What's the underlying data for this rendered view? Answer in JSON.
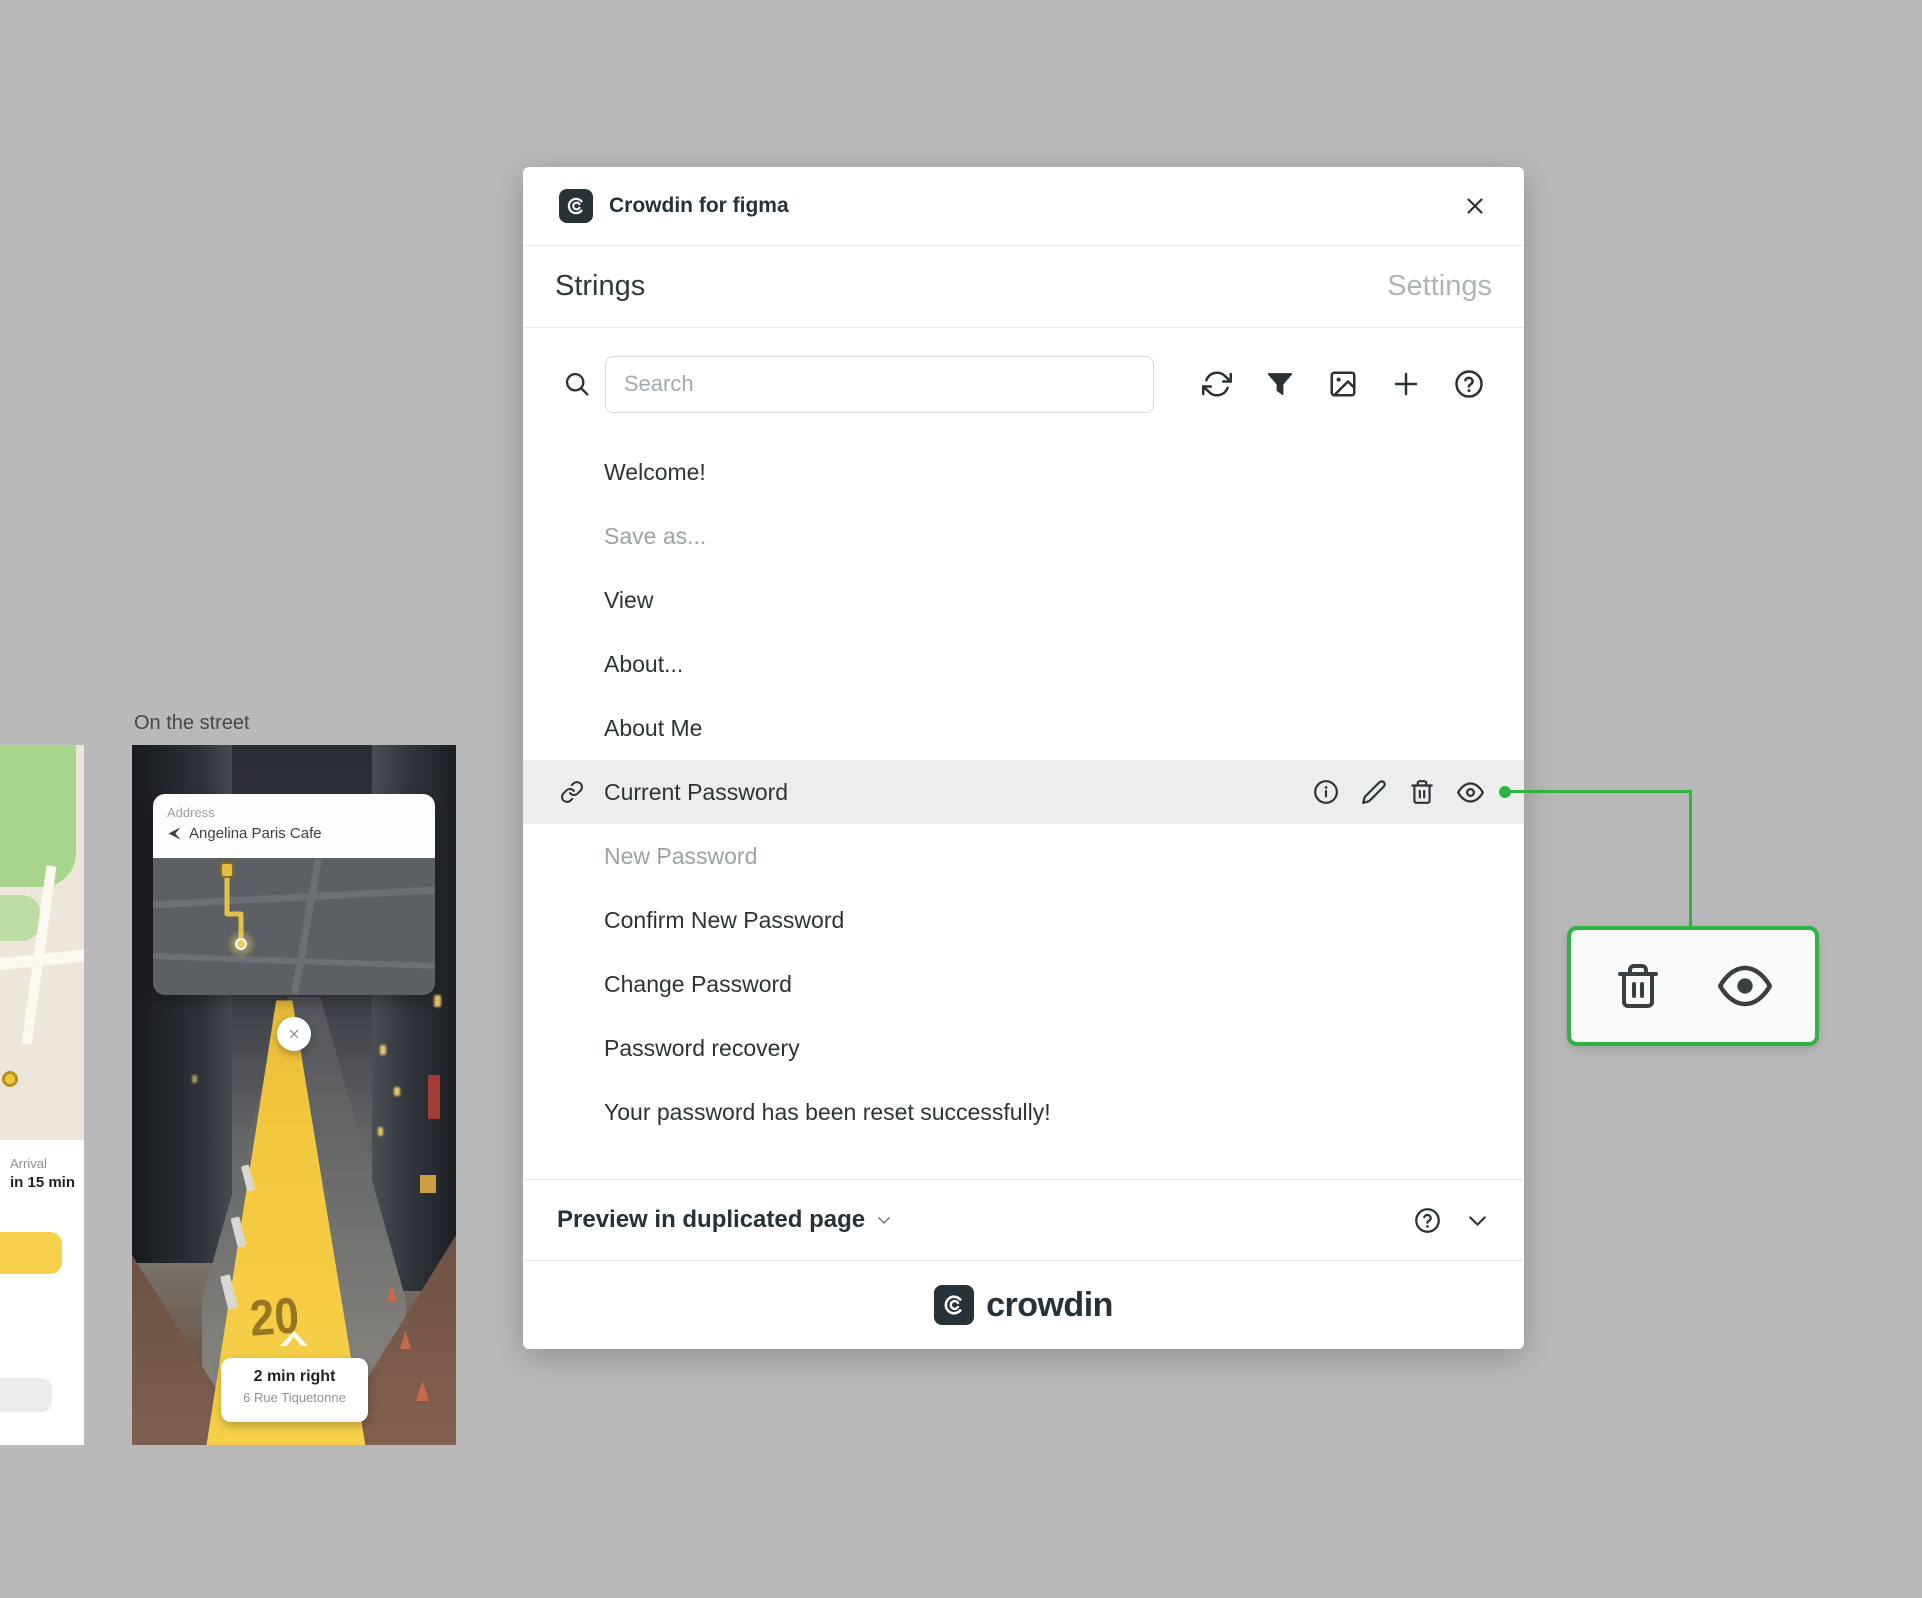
{
  "colors": {
    "accent_green": "#2FB344",
    "brand_dark": "#263238",
    "selected_row_bg": "#EDEDED",
    "canvas_bg": "#B9B9B9",
    "route_yellow": "#F3C83E"
  },
  "canvas": {
    "street_frame_label": "On the street"
  },
  "nav_app": {
    "address_label": "Address",
    "address_value": "Angelina Paris Cafe",
    "direction_primary": "2 min right",
    "direction_secondary": "6 Rue Tiquetonne",
    "path_number": "20",
    "arrival_label": "Arrival",
    "arrival_value": "in 15 min"
  },
  "plugin": {
    "window_title": "Crowdin for figma",
    "tabs": [
      {
        "label": "Strings"
      },
      {
        "label": "Settings"
      }
    ],
    "search": {
      "placeholder": "Search"
    },
    "toolbar_icons": [
      "refresh-icon",
      "filter-icon",
      "screenshot-icon",
      "add-icon",
      "help-icon"
    ],
    "strings": [
      {
        "label": "Welcome!",
        "state": "default"
      },
      {
        "label": "Save as...",
        "state": "muted"
      },
      {
        "label": "View",
        "state": "default"
      },
      {
        "label": "About...",
        "state": "default"
      },
      {
        "label": "About Me",
        "state": "default"
      },
      {
        "label": "Current Password",
        "state": "selected"
      },
      {
        "label": "New Password",
        "state": "muted"
      },
      {
        "label": "Confirm New Password",
        "state": "default"
      },
      {
        "label": "Change Password",
        "state": "default"
      },
      {
        "label": "Password recovery",
        "state": "default"
      },
      {
        "label": "Your password has been reset successfully!",
        "state": "default"
      }
    ],
    "row_actions": [
      "info-icon",
      "edit-icon",
      "delete-icon",
      "visibility-icon"
    ],
    "preview": {
      "label": "Preview in duplicated page"
    },
    "footer": {
      "brand": "crowdin"
    }
  },
  "callout": {
    "icons": [
      "delete-icon",
      "visibility-icon"
    ]
  }
}
